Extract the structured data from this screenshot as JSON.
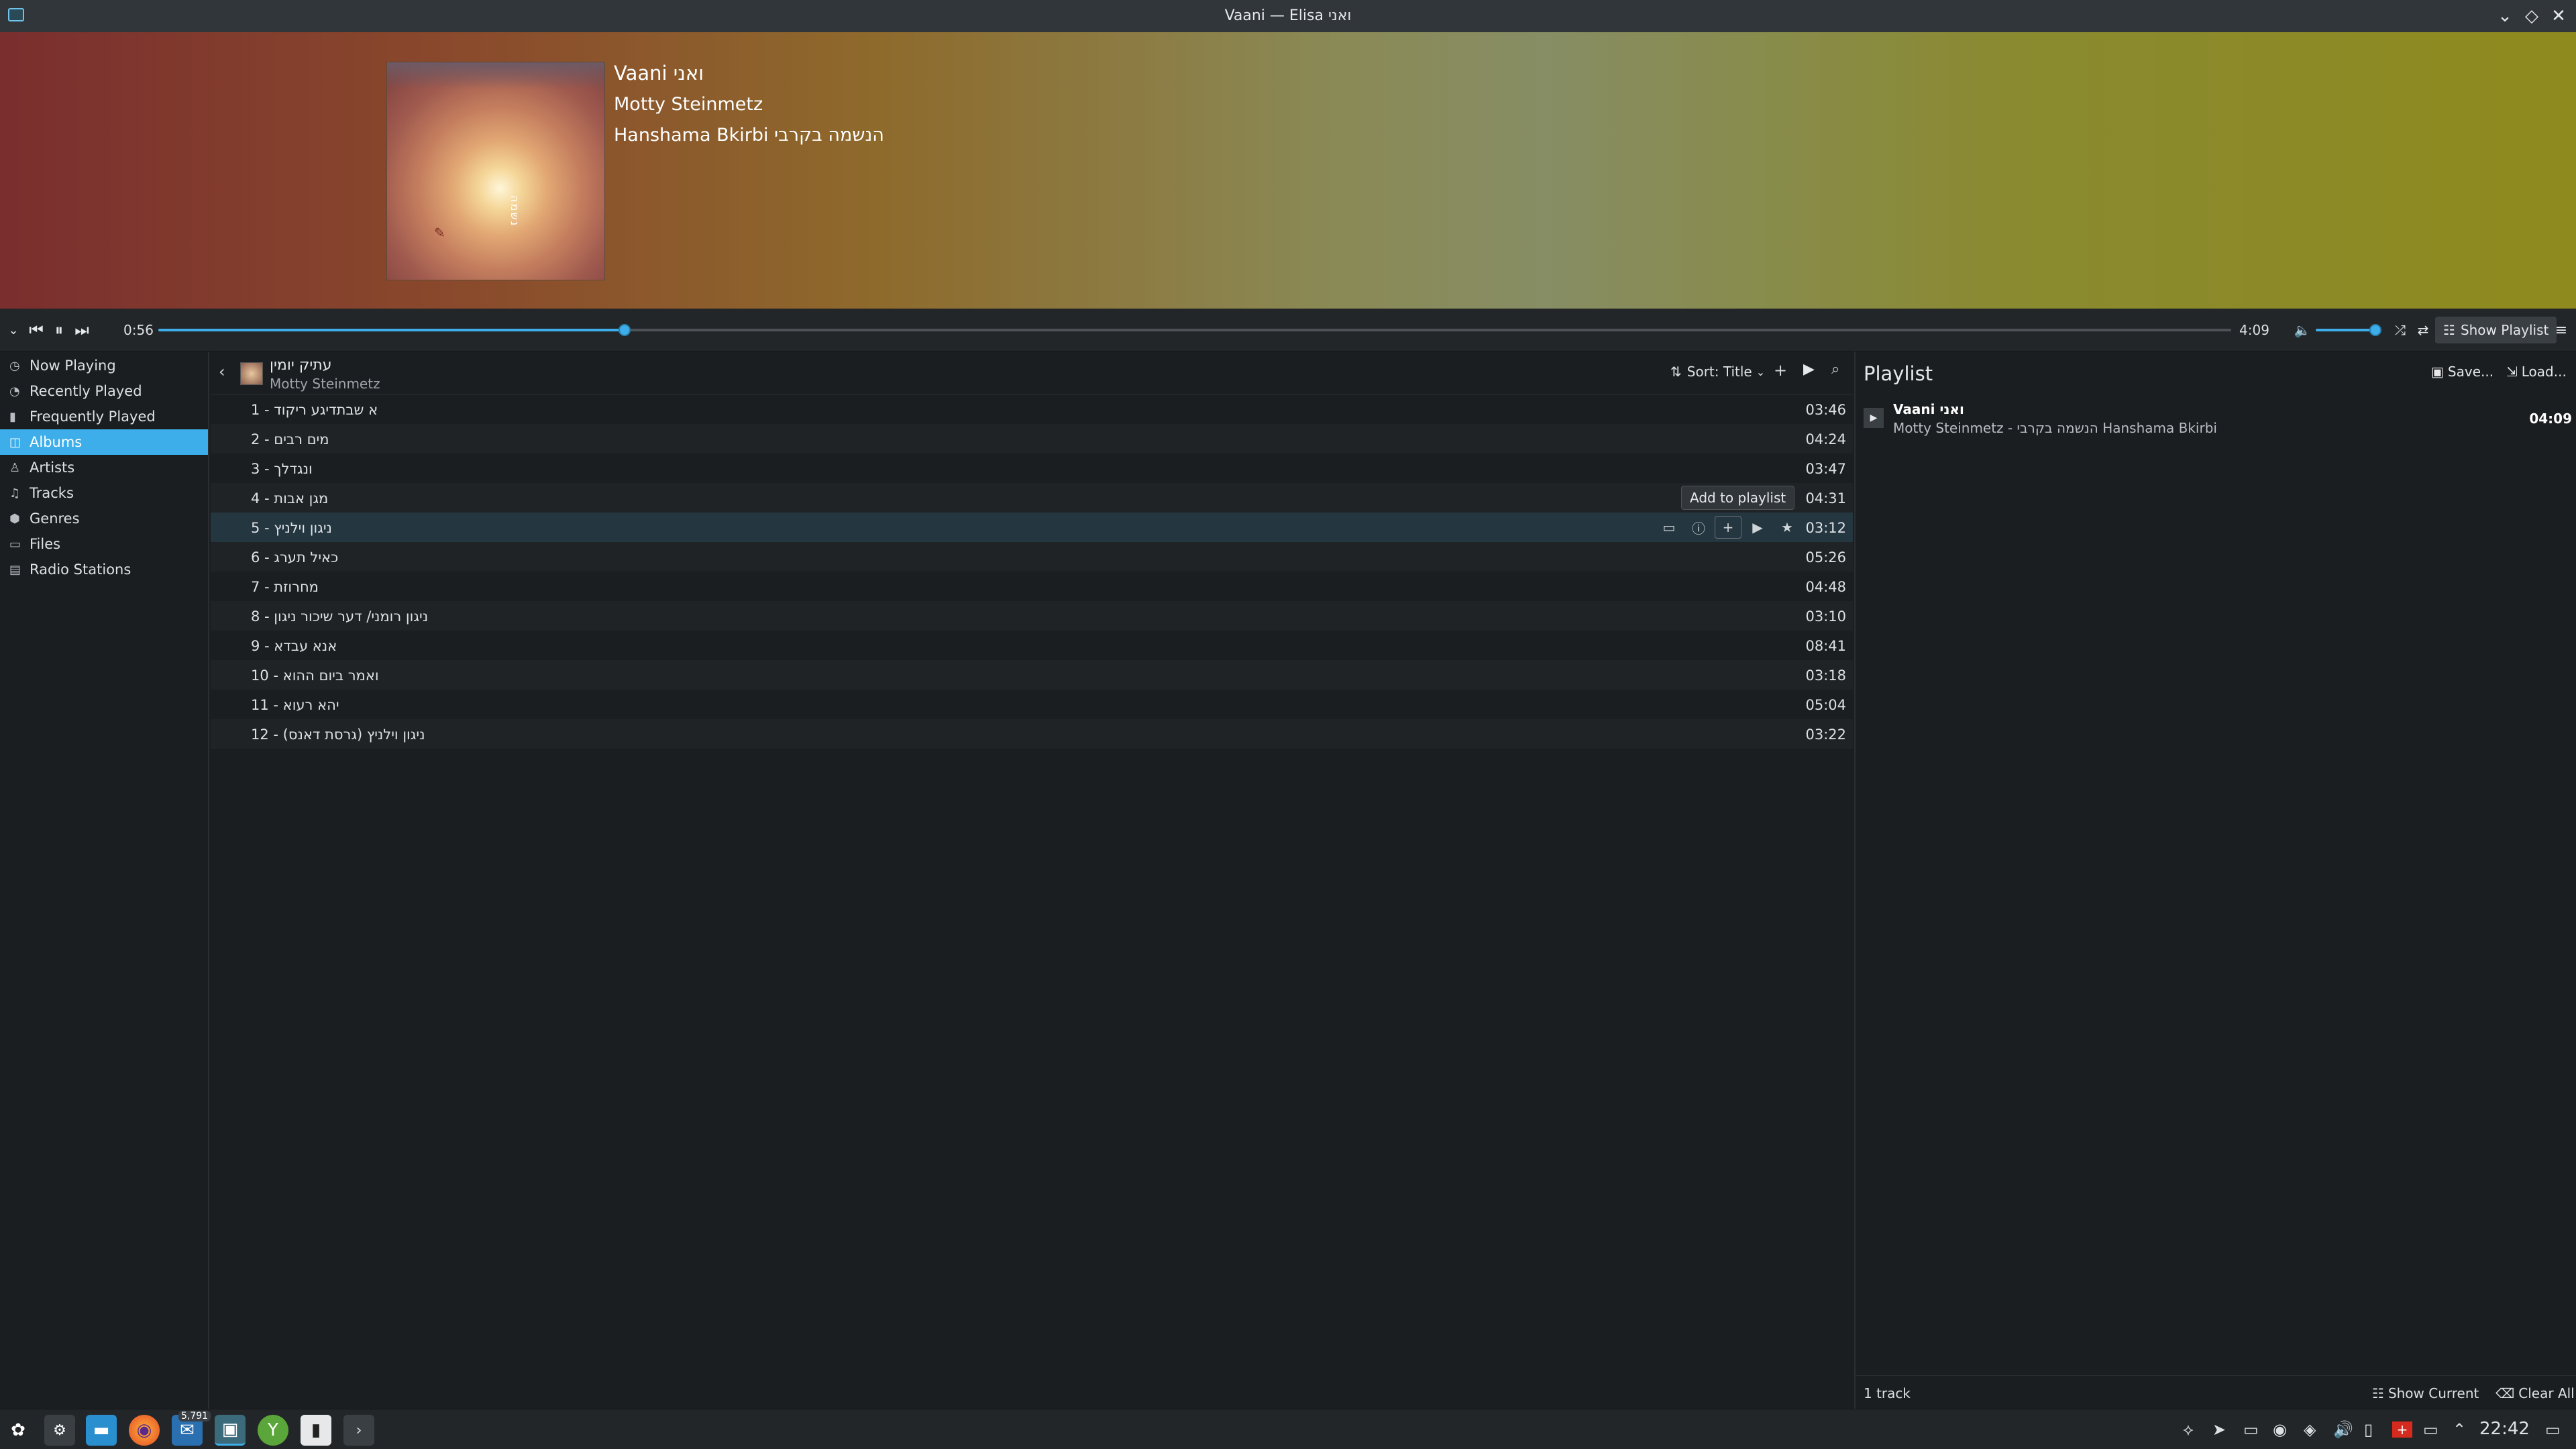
{
  "window": {
    "title": "Vaani — Elisa ואני"
  },
  "now_playing": {
    "title": "Vaani ואני",
    "artist": "Motty Steinmetz",
    "album": "Hanshama Bkirbi הנשמה בקרבי",
    "cover_text": "נשמה"
  },
  "transport": {
    "elapsed": "0:56",
    "total": "4:09",
    "progress": 0.2249,
    "volume": 0.9,
    "show_playlist_label": "Show Playlist"
  },
  "sidebar": {
    "items": [
      {
        "label": "Now Playing",
        "icon": "now-playing-icon",
        "glyph": "◷"
      },
      {
        "label": "Recently Played",
        "icon": "clock-icon",
        "glyph": "◔"
      },
      {
        "label": "Frequently Played",
        "icon": "bar-chart-icon",
        "glyph": "▮"
      },
      {
        "label": "Albums",
        "icon": "album-icon",
        "glyph": "◫"
      },
      {
        "label": "Artists",
        "icon": "person-icon",
        "glyph": "♙"
      },
      {
        "label": "Tracks",
        "icon": "music-note-icon",
        "glyph": "♫"
      },
      {
        "label": "Genres",
        "icon": "tag-icon",
        "glyph": "⬢"
      },
      {
        "label": "Files",
        "icon": "folder-icon",
        "glyph": "▭"
      },
      {
        "label": "Radio Stations",
        "icon": "radio-icon",
        "glyph": "▤"
      }
    ],
    "active_index": 3
  },
  "album_view": {
    "album_title": "עתיק יומין",
    "album_artist": "Motty Steinmetz",
    "sort_label": "Sort: Title",
    "tooltip": "Add to playlist",
    "tracks": [
      {
        "name": "1 - א שבתדיגע ריקוד",
        "duration": "03:46"
      },
      {
        "name": "2 - מים רבים",
        "duration": "04:24"
      },
      {
        "name": "3 - ונגדלך",
        "duration": "03:47"
      },
      {
        "name": "4 - מגן אבות",
        "duration": "04:31"
      },
      {
        "name": "5 - ניגון וילניץ",
        "duration": "03:12"
      },
      {
        "name": "6 - כאיל תערג",
        "duration": "05:26"
      },
      {
        "name": "7 - מחרוזת",
        "duration": "04:48"
      },
      {
        "name": "8 - ניגון רומני/ דער שיכור ניגון",
        "duration": "03:10"
      },
      {
        "name": "9 - אנא עבדא",
        "duration": "08:41"
      },
      {
        "name": "10 - ואמר ביום ההוא",
        "duration": "03:18"
      },
      {
        "name": "11 - יהא רעוא",
        "duration": "05:04"
      },
      {
        "name": "12 - ניגון וילניץ (גרסת דאנס)",
        "duration": "03:22"
      }
    ],
    "highlighted_index": 4
  },
  "playlist": {
    "title": "Playlist",
    "save_label": "Save...",
    "load_label": "Load...",
    "entries": [
      {
        "title": "Vaani ואני",
        "subtitle": "Motty Steinmetz - הנשמה בקרבי Hanshama Bkirbi",
        "duration": "04:09"
      }
    ],
    "count_label": "1 track",
    "show_current_label": "Show Current",
    "clear_all_label": "Clear All"
  },
  "taskbar": {
    "clock": "22:42",
    "badge": "5,791"
  },
  "colors": {
    "accent": "#3daee9",
    "background": "#1b1e20",
    "titlebar": "#31363b"
  }
}
